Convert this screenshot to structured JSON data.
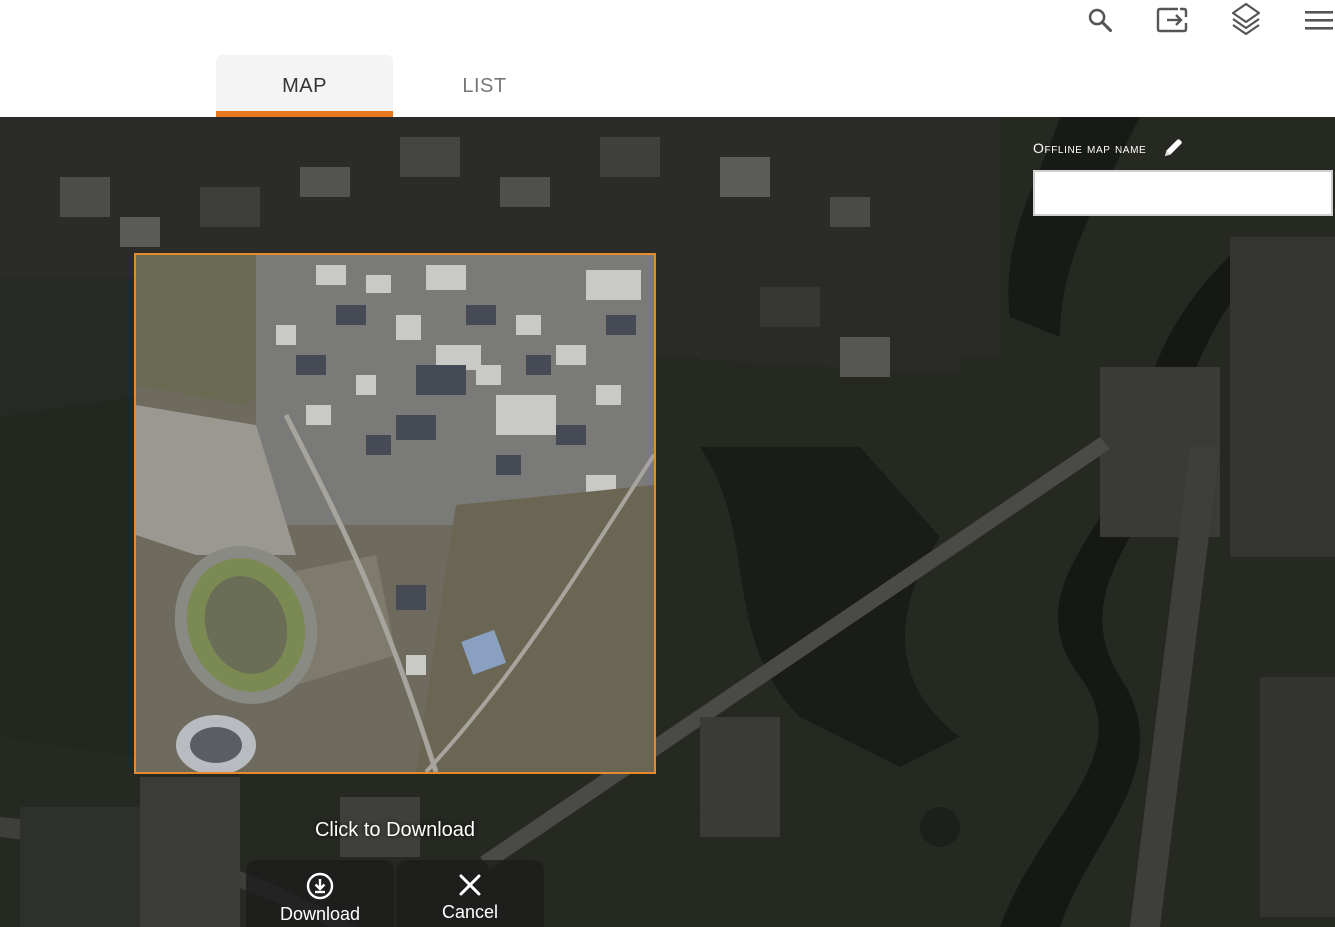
{
  "toolbar": {
    "search_icon": "search-icon",
    "exit_icon": "exit-to-app-icon",
    "layers_icon": "layers-icon",
    "menu_icon": "hamburger-menu-icon"
  },
  "tabs": [
    {
      "label": "MAP",
      "active": true
    },
    {
      "label": "LIST",
      "active": false
    }
  ],
  "offline": {
    "label": "Offline map name",
    "value": "",
    "edit_icon": "pencil-icon"
  },
  "download": {
    "hint": "Click to Download",
    "download_label": "Download",
    "cancel_label": "Cancel"
  },
  "colors": {
    "accent": "#e87722",
    "selection_border": "#e8892a",
    "map_dark": "#262822"
  }
}
